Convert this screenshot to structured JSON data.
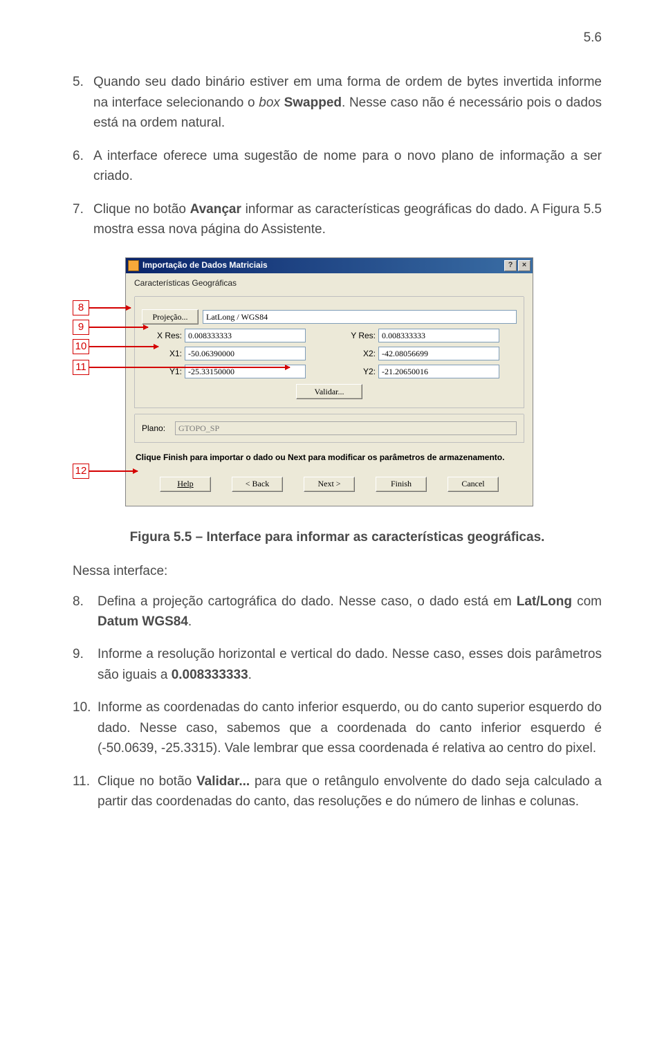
{
  "page_number": "5.6",
  "item5": {
    "num": "5.",
    "t1": "Quando seu dado binário estiver em uma forma de ordem de bytes invertida informe na interface selecionando o ",
    "box": "box",
    "sp": " ",
    "swapped": "Swapped",
    "t2": ". Nesse caso não é necessário pois o dados está na ordem natural."
  },
  "item6": {
    "num": "6.",
    "t": "A interface oferece uma sugestão de nome para o novo plano de informação a ser criado."
  },
  "item7": {
    "num": "7.",
    "t1": "Clique no botão ",
    "avancar": "Avançar",
    "t2": " informar as características geográficas do dado. A Figura 5.5 mostra essa nova página do Assistente."
  },
  "dialog": {
    "title": "Importação de Dados Matriciais",
    "help_btn": "?",
    "close_btn": "×",
    "subtitle": "Características Geográficas",
    "proj_btn": "Projeção...",
    "proj_val": "LatLong / WGS84",
    "xres_lbl": "X Res:",
    "xres_val": "0.008333333",
    "yres_lbl": "Y Res:",
    "yres_val": "0.008333333",
    "x1_lbl": "X1:",
    "x1_val": "-50.06390000",
    "x2_lbl": "X2:",
    "x2_val": "-42.08056699",
    "y1_lbl": "Y1:",
    "y1_val": "-25.33150000",
    "y2_lbl": "Y2:",
    "y2_val": "-21.20650016",
    "validar_btn": "Validar...",
    "plano_lbl": "Plano:",
    "plano_val": "GTOPO_SP",
    "instr": "Clique Finish para importar o dado ou Next para modificar os parâmetros de armazenamento.",
    "help": "Help",
    "back": "< Back",
    "next": "Next >",
    "finish": "Finish",
    "cancel": "Cancel"
  },
  "callout": {
    "c8": "8",
    "c9": "9",
    "c10": "10",
    "c11": "11",
    "c12": "12"
  },
  "caption": "Figura 5.5 – Interface para informar as características geográficas.",
  "nessa": "Nessa interface:",
  "item8": {
    "num": "8.",
    "t1": "Defina a projeção cartográfica do dado. Nesse caso, o dado está em ",
    "latlong": "Lat/Long",
    "t2": " com ",
    "datum": "Datum WGS84",
    "t3": "."
  },
  "item9": {
    "num": "9.",
    "t1": "Informe a resolução horizontal e vertical do dado. Nesse caso, esses dois parâmetros são iguais a ",
    "val": "0.008333333",
    "t2": "."
  },
  "item10": {
    "num": "10.",
    "t": "Informe as coordenadas do canto inferior esquerdo, ou do canto superior esquerdo do dado. Nesse caso, sabemos que a coordenada do canto inferior esquerdo é (-50.0639, -25.3315). Vale lembrar que essa coordenada é relativa ao centro do pixel."
  },
  "item11": {
    "num": "11.",
    "t1": "Clique no botão ",
    "validar": "Validar...",
    "t2": " para que o retângulo envolvente do dado seja calculado a partir das coordenadas do canto, das resoluções e do número de linhas e colunas."
  }
}
